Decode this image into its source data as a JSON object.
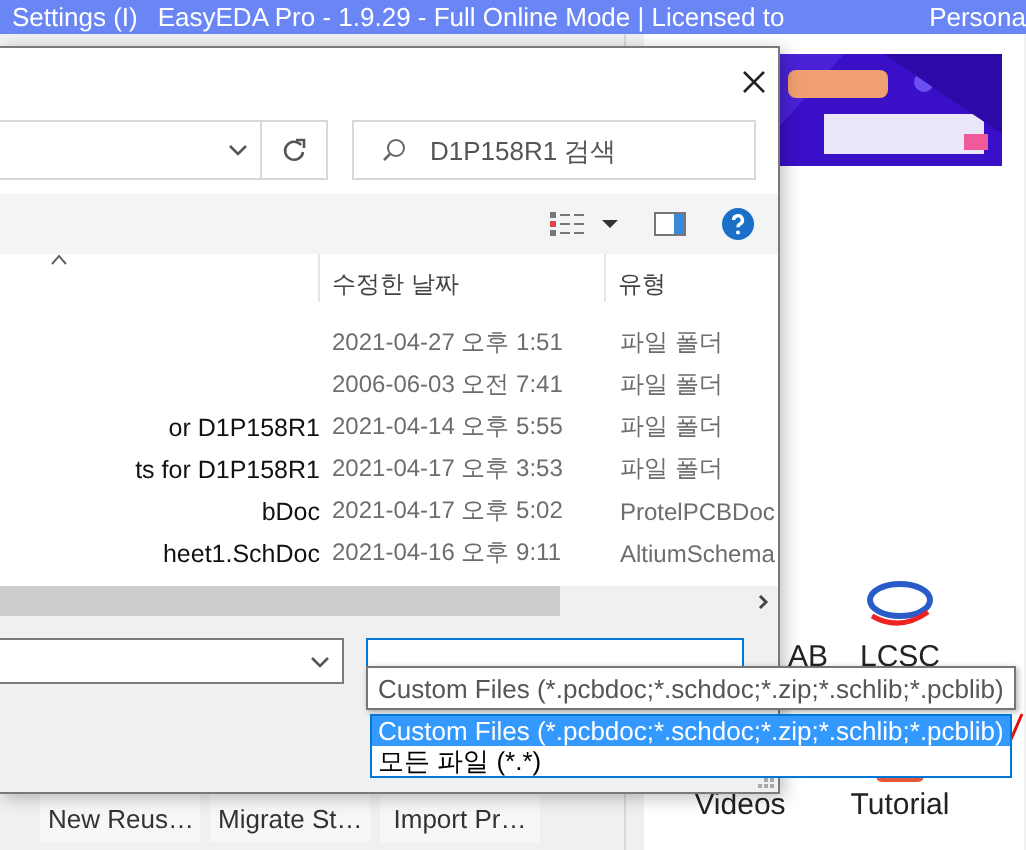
{
  "app": {
    "title_bar": [
      "Settings (I)",
      "EasyEDA Pro - 1.9.29 - Full Online Mode | Licensed to",
      "Persona"
    ],
    "quick_buttons": [
      "New Reus…",
      "Migrate St…",
      "Import Pr…"
    ],
    "shortcuts": [
      {
        "label": "AB"
      },
      {
        "label": "LCSC"
      },
      {
        "label": "Videos"
      },
      {
        "label": "Tutorial"
      }
    ]
  },
  "dialog": {
    "search": {
      "placeholder": "D1P158R1 검색"
    },
    "columns": [
      "수정한 날짜",
      "유형"
    ],
    "rows": [
      {
        "modified": "2021-04-27 오후 1:51",
        "type": "파일 폴더"
      },
      {
        "modified": "2006-06-03 오전 7:41",
        "type": "파일 폴더"
      },
      {
        "name": "or D1P158R1",
        "modified": "2021-04-14 오후 5:55",
        "type": "파일 폴더"
      },
      {
        "name": "ts for D1P158R1",
        "modified": "2021-04-17 오후 3:53",
        "type": "파일 폴더"
      },
      {
        "name": "bDoc",
        "modified": "2021-04-17 오후 5:02",
        "type": "ProtelPCBDoc"
      },
      {
        "name": "heet1.SchDoc",
        "modified": "2021-04-16 오후 9:11",
        "type": "AltiumSchema"
      }
    ],
    "file_type": {
      "tooltip": "Custom Files (*.pcbdoc;*.schdoc;*.zip;*.schlib;*.pcblib)",
      "options": [
        {
          "label": "Custom Files (*.pcbdoc;*.schdoc;*.zip;*.schlib;*.pcblib)",
          "selected": true
        },
        {
          "label": "모든 파일 (*.*)",
          "selected": false
        }
      ]
    }
  }
}
